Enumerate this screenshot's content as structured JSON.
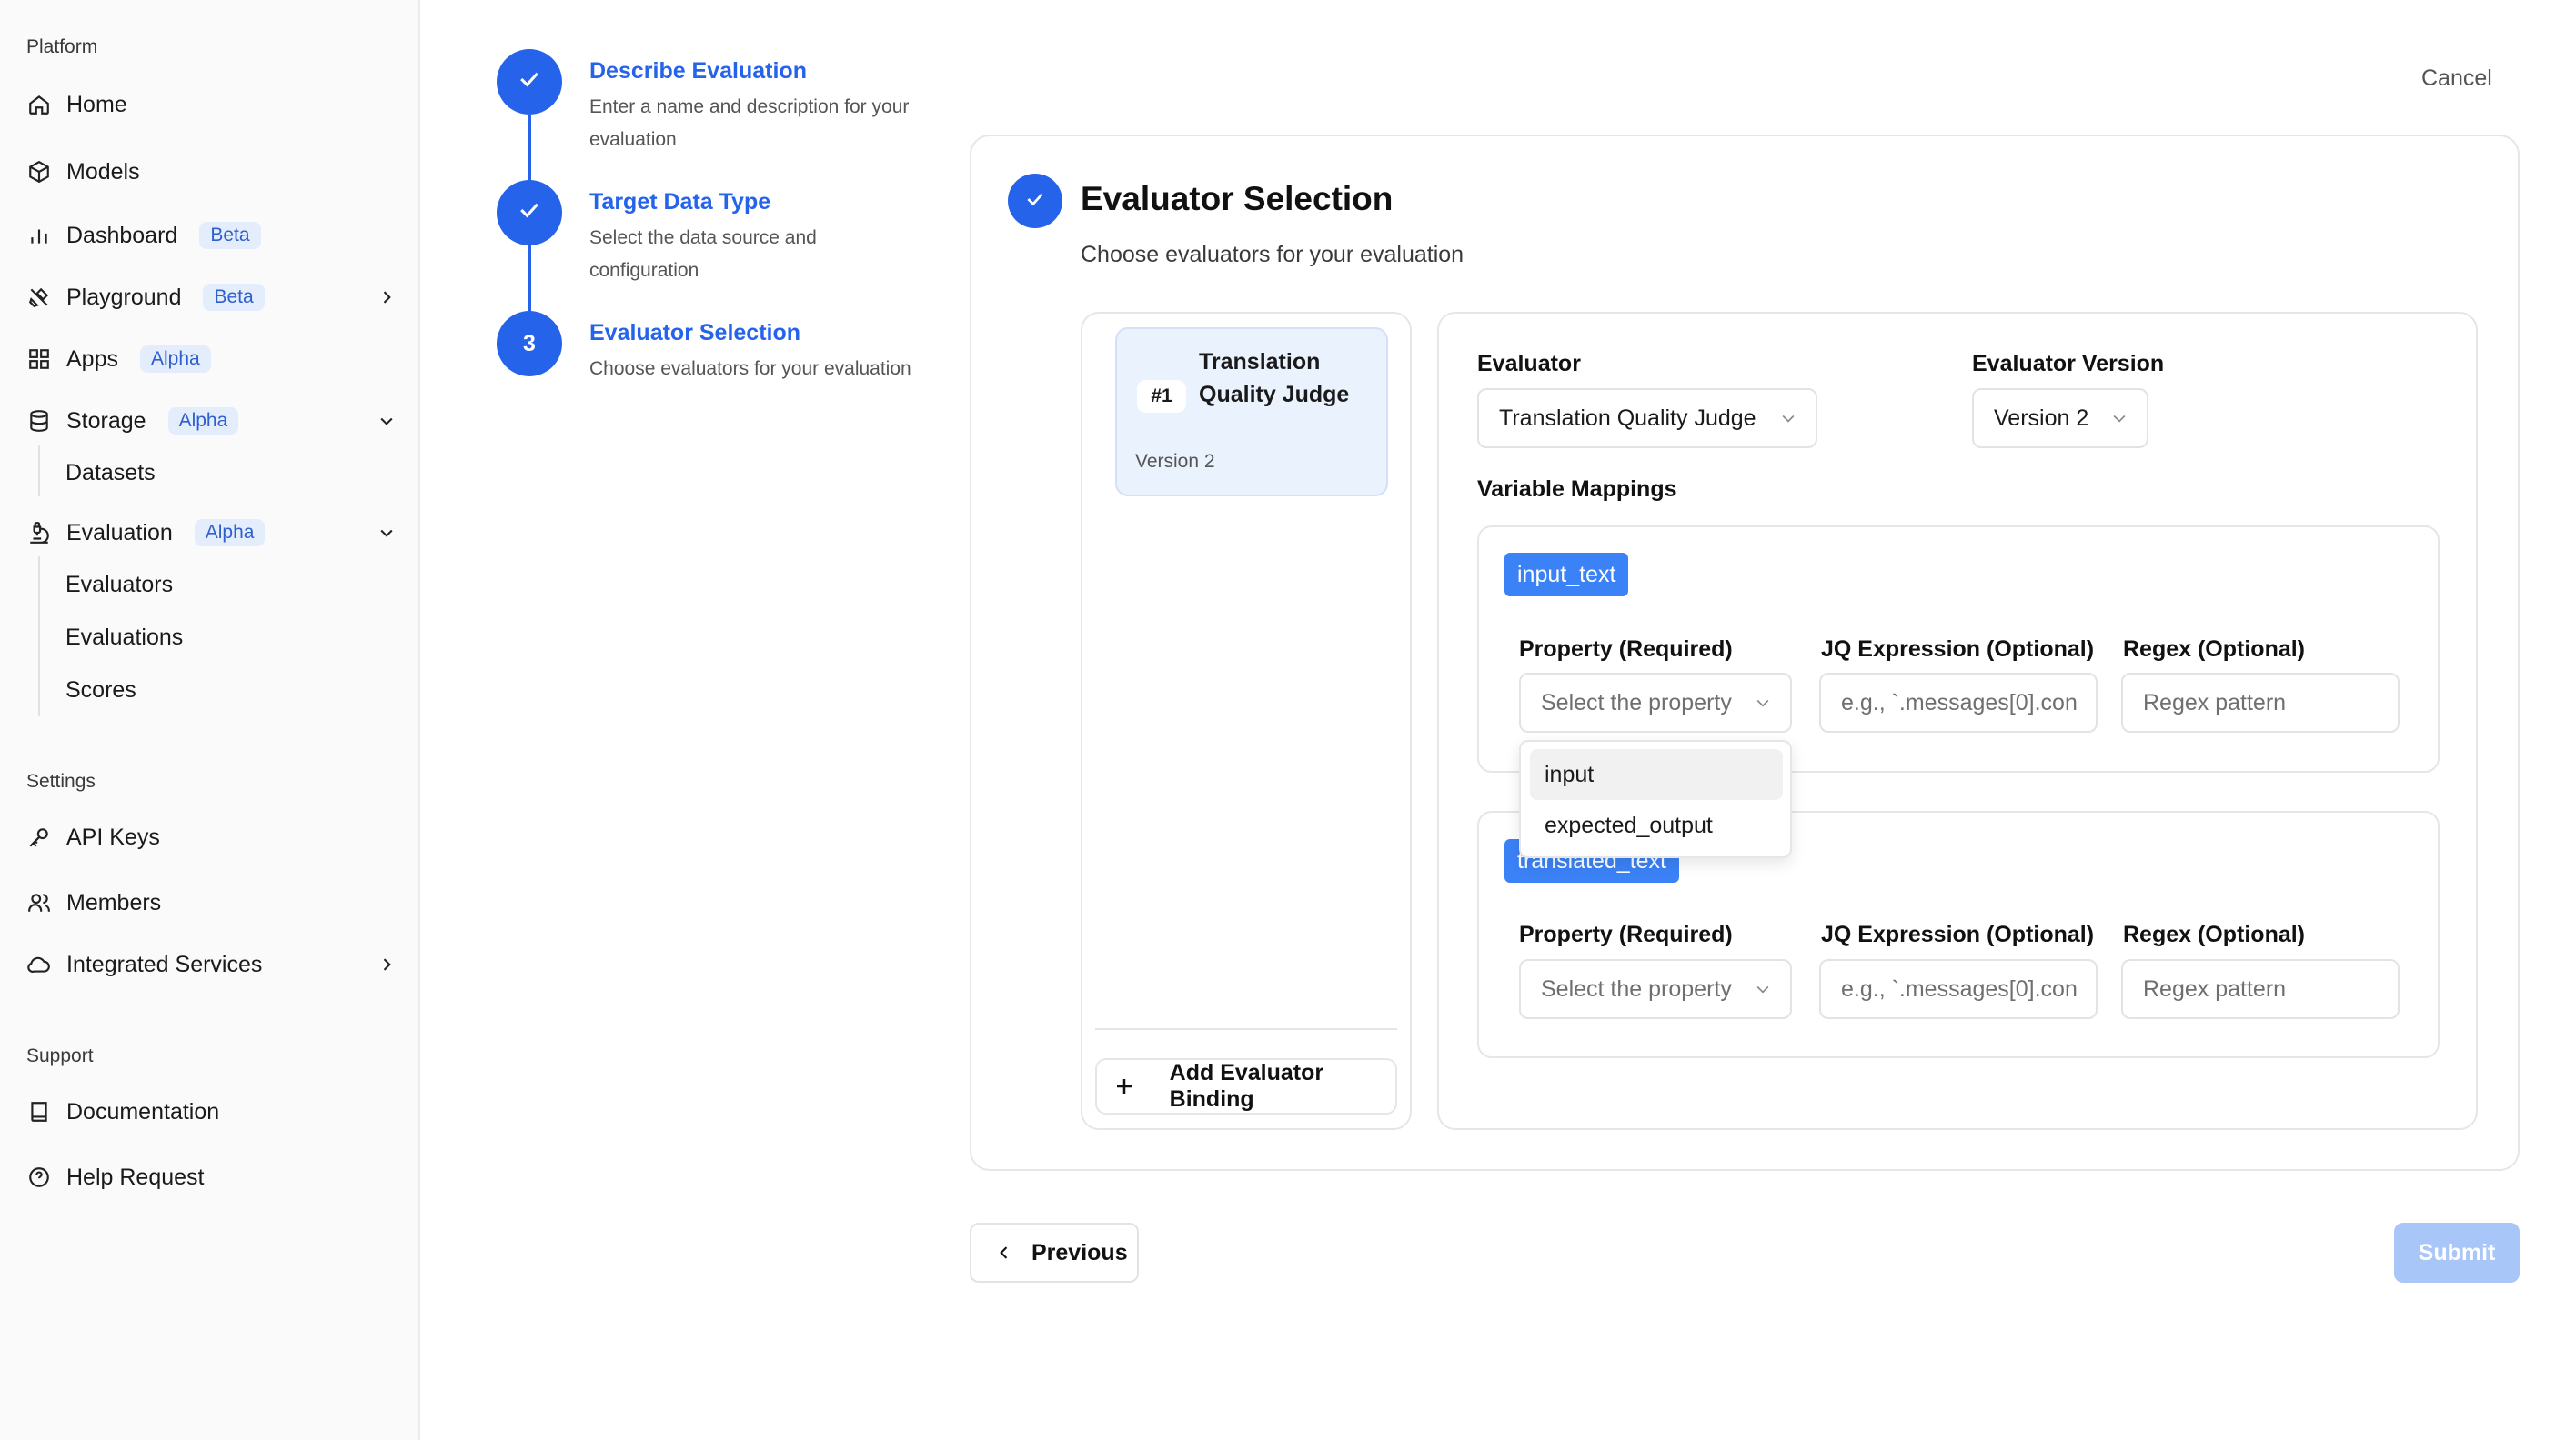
{
  "sidebar": {
    "platform_title": "Platform",
    "settings_title": "Settings",
    "support_title": "Support",
    "items": {
      "home": "Home",
      "models": "Models",
      "dashboard": "Dashboard",
      "dashboard_badge": "Beta",
      "playground": "Playground",
      "playground_badge": "Beta",
      "apps": "Apps",
      "apps_badge": "Alpha",
      "storage": "Storage",
      "storage_badge": "Alpha",
      "datasets": "Datasets",
      "evaluation": "Evaluation",
      "evaluation_badge": "Alpha",
      "evaluators": "Evaluators",
      "evaluations": "Evaluations",
      "scores": "Scores",
      "api_keys": "API Keys",
      "members": "Members",
      "integrated_services": "Integrated Services",
      "documentation": "Documentation",
      "help_request": "Help Request"
    }
  },
  "stepper": {
    "steps": [
      {
        "title": "Describe Evaluation",
        "desc": "Enter a name and description for your evaluation"
      },
      {
        "title": "Target Data Type",
        "desc": "Select the data source and configuration"
      },
      {
        "title": "Evaluator Selection",
        "desc": "Choose evaluators for your evaluation",
        "number": "3"
      }
    ]
  },
  "header": {
    "cancel": "Cancel"
  },
  "card": {
    "title": "Evaluator Selection",
    "subtitle": "Choose evaluators for your evaluation",
    "evaluator_item": {
      "num": "#1",
      "name": "Translation Quality Judge",
      "version": "Version 2"
    },
    "add_binding": "Add Evaluator Binding",
    "evaluator_label": "Evaluator",
    "evaluator_value": "Translation Quality Judge",
    "version_label": "Evaluator Version",
    "version_value": "Version 2",
    "mappings_label": "Variable Mappings",
    "mappings": [
      {
        "variable": "input_text",
        "property_label": "Property (Required)",
        "property_placeholder": "Select the property",
        "jq_label": "JQ Expression (Optional)",
        "jq_placeholder": "e.g., `.messages[0].con",
        "regex_label": "Regex (Optional)",
        "regex_placeholder": "Regex pattern"
      },
      {
        "variable": "translated_text",
        "property_label": "Property (Required)",
        "property_placeholder": "Select the property",
        "jq_label": "JQ Expression (Optional)",
        "jq_placeholder": "e.g., `.messages[0].con",
        "regex_label": "Regex (Optional)",
        "regex_placeholder": "Regex pattern"
      }
    ],
    "dropdown_options": [
      "input",
      "expected_output"
    ]
  },
  "footer": {
    "previous": "Previous",
    "submit": "Submit"
  },
  "colors": {
    "accent": "#2563eb",
    "tag": "#3b82f6",
    "submit_disabled": "#a9c6f8"
  }
}
